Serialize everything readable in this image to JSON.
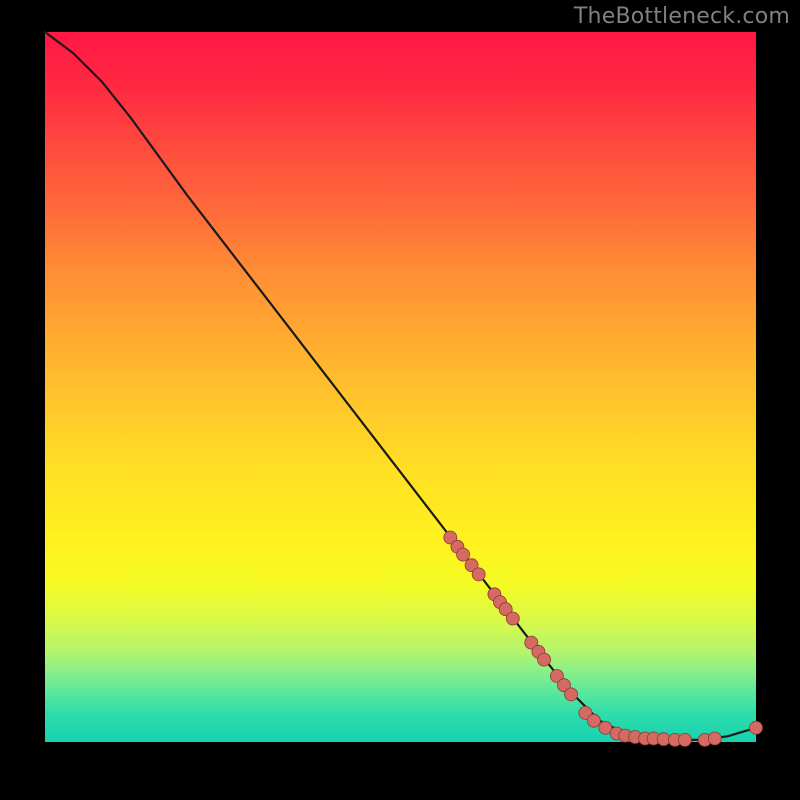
{
  "attribution": "TheBottleneck.com",
  "chart_data": {
    "type": "line",
    "title": "",
    "xlabel": "",
    "ylabel": "",
    "xlim": [
      0,
      100
    ],
    "ylim": [
      0,
      100
    ],
    "grid": false,
    "legend": false,
    "series": [
      {
        "name": "curve",
        "x": [
          0,
          4,
          8,
          12,
          20,
          30,
          40,
          50,
          60,
          70,
          74,
          78,
          82,
          85,
          88,
          92,
          96,
          100
        ],
        "y": [
          100,
          97,
          93,
          88,
          77,
          64,
          51,
          38,
          25,
          12,
          7,
          3,
          1,
          0.5,
          0.3,
          0.3,
          0.8,
          2
        ]
      }
    ],
    "markers": {
      "name": "dots",
      "comment": "salmon dots along the lower-right of the curve",
      "xy": [
        [
          57,
          28.8
        ],
        [
          58,
          27.5
        ],
        [
          58.8,
          26.4
        ],
        [
          60,
          24.9
        ],
        [
          61,
          23.6
        ],
        [
          63.2,
          20.8
        ],
        [
          64,
          19.7
        ],
        [
          64.8,
          18.7
        ],
        [
          65.8,
          17.4
        ],
        [
          68.4,
          14.0
        ],
        [
          69.4,
          12.7
        ],
        [
          70.2,
          11.6
        ],
        [
          72.0,
          9.3
        ],
        [
          73.0,
          8.0
        ],
        [
          74.0,
          6.7
        ],
        [
          76.0,
          4.1
        ],
        [
          77.2,
          3.0
        ],
        [
          78.8,
          2.0
        ],
        [
          80.4,
          1.2
        ],
        [
          81.6,
          0.9
        ],
        [
          83.0,
          0.7
        ],
        [
          84.4,
          0.5
        ],
        [
          85.6,
          0.5
        ],
        [
          87.0,
          0.4
        ],
        [
          88.6,
          0.3
        ],
        [
          90.0,
          0.3
        ],
        [
          92.8,
          0.3
        ],
        [
          94.2,
          0.5
        ],
        [
          100,
          2.0
        ]
      ]
    }
  }
}
